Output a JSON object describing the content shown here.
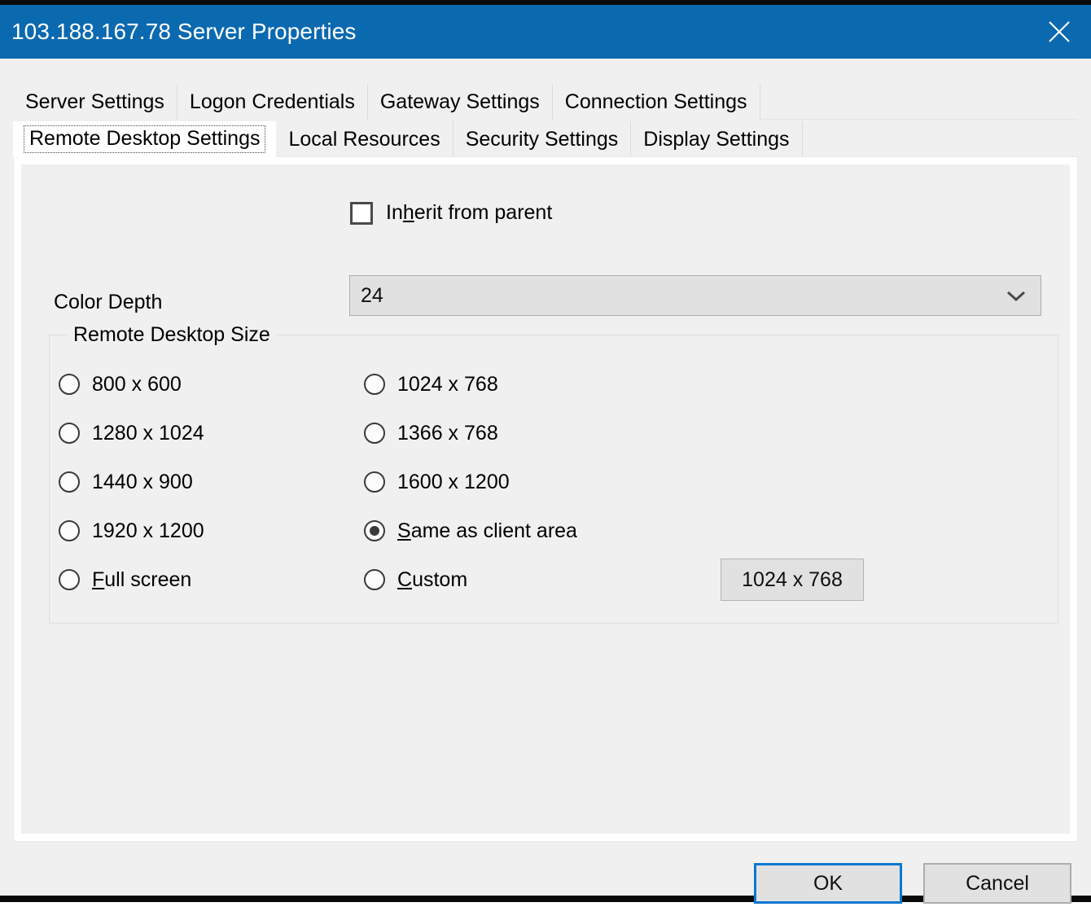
{
  "window": {
    "title": "103.188.167.78 Server Properties",
    "close_icon": "close-icon",
    "accent_color": "#0b69b0"
  },
  "tabs": {
    "row1": [
      {
        "label": "Server Settings",
        "selected": false
      },
      {
        "label": "Logon Credentials",
        "selected": false
      },
      {
        "label": "Gateway Settings",
        "selected": false
      },
      {
        "label": "Connection Settings",
        "selected": false
      }
    ],
    "row2": [
      {
        "label": "Remote Desktop Settings",
        "selected": true
      },
      {
        "label": "Local Resources",
        "selected": false
      },
      {
        "label": "Security Settings",
        "selected": false
      },
      {
        "label": "Display Settings",
        "selected": false
      }
    ]
  },
  "panel": {
    "inherit": {
      "label_before": "In",
      "label_accel": "h",
      "label_after": "erit from parent",
      "full_label": "Inherit from parent",
      "checked": false
    },
    "color_depth": {
      "label": "Color Depth",
      "value": "24",
      "arrow_icon": "chevron-down-icon"
    },
    "remote_desktop_size": {
      "group_title": "Remote Desktop Size",
      "rows": [
        {
          "left": {
            "label": "800 x 600",
            "checked": false,
            "accel": ""
          },
          "right": {
            "label": "1024 x 768",
            "checked": false,
            "accel": ""
          }
        },
        {
          "left": {
            "label": "1280 x 1024",
            "checked": false,
            "accel": ""
          },
          "right": {
            "label": "1366 x 768",
            "checked": false,
            "accel": ""
          }
        },
        {
          "left": {
            "label": "1440 x 900",
            "checked": false,
            "accel": ""
          },
          "right": {
            "label": "1600 x 1200",
            "checked": false,
            "accel": ""
          }
        },
        {
          "left": {
            "label": "1920 x 1200",
            "checked": false,
            "accel": ""
          },
          "right": {
            "label": "Same as client area",
            "checked": true,
            "accel": "S"
          }
        },
        {
          "left": {
            "label": "Full screen",
            "checked": false,
            "accel": "F"
          },
          "right": {
            "label": "Custom",
            "checked": false,
            "accel": "C"
          }
        }
      ],
      "custom_value": "1024 x 768"
    }
  },
  "footer": {
    "ok_label": "OK",
    "cancel_label": "Cancel"
  }
}
